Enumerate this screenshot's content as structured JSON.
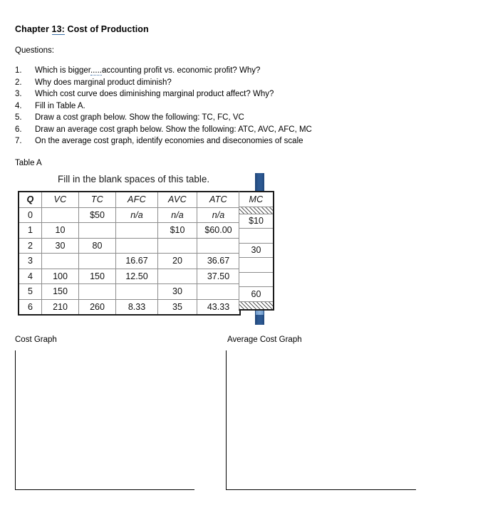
{
  "document": {
    "chapter": {
      "prefix": "Chapter",
      "number": "13",
      "colon": ":",
      "title": "Cost of Production"
    },
    "questions_label": "Questions:",
    "questions": [
      {
        "num": "1.",
        "pre": "Which is bigger",
        "dots": ".....",
        "post": "accounting profit vs. economic profit?  Why?"
      },
      {
        "num": "2.",
        "pre": "Why does marginal product diminish?",
        "dots": "",
        "post": ""
      },
      {
        "num": "3.",
        "pre": "Which cost curve does diminishing marginal product affect? Why?",
        "dots": "",
        "post": ""
      },
      {
        "num": "4.",
        "pre": "Fill in Table A.",
        "dots": "",
        "post": ""
      },
      {
        "num": "5.",
        "pre": "Draw a cost graph below. Show the following: TC, FC, VC",
        "dots": "",
        "post": ""
      },
      {
        "num": "6.",
        "pre": "Draw an average cost graph below. Show the following: ATC, AVC, AFC, MC",
        "dots": "",
        "post": ""
      },
      {
        "num": "7.",
        "pre": "On the average cost graph, identify economies and diseconomies of scale",
        "dots": "",
        "post": ""
      }
    ],
    "table_a_label": "Table A"
  },
  "table": {
    "caption": "Fill in the blank spaces of this table.",
    "headers": [
      "Q",
      "VC",
      "TC",
      "AFC",
      "AVC",
      "ATC"
    ],
    "mc_header": "MC",
    "rows": [
      {
        "q": "0",
        "vc": "",
        "tc": "$50",
        "afc": "n/a",
        "avc": "n/a",
        "atc": "n/a",
        "italic": true
      },
      {
        "q": "1",
        "vc": "10",
        "tc": "",
        "afc": "",
        "avc": "$10",
        "atc": "$60.00",
        "italic": false
      },
      {
        "q": "2",
        "vc": "30",
        "tc": "80",
        "afc": "",
        "avc": "",
        "atc": "",
        "italic": false
      },
      {
        "q": "3",
        "vc": "",
        "tc": "",
        "afc": "16.67",
        "avc": "20",
        "atc": "36.67",
        "italic": false
      },
      {
        "q": "4",
        "vc": "100",
        "tc": "150",
        "afc": "12.50",
        "avc": "",
        "atc": "37.50",
        "italic": false
      },
      {
        "q": "5",
        "vc": "150",
        "tc": "",
        "afc": "",
        "avc": "30",
        "atc": "",
        "italic": false
      },
      {
        "q": "6",
        "vc": "210",
        "tc": "260",
        "afc": "8.33",
        "avc": "35",
        "atc": "43.33",
        "italic": false
      }
    ],
    "mc_values": [
      "",
      "$10",
      "",
      "30",
      "",
      "",
      "60",
      ""
    ],
    "colors": {
      "scrollbar": "#2d5992",
      "scrollbar_thumb": "#7ba2d0",
      "table_border": "#1a1a1a",
      "grid_line": "#8d8d8d"
    }
  },
  "graphs": {
    "left_label": "Cost Graph",
    "right_label": "Average Cost Graph"
  }
}
